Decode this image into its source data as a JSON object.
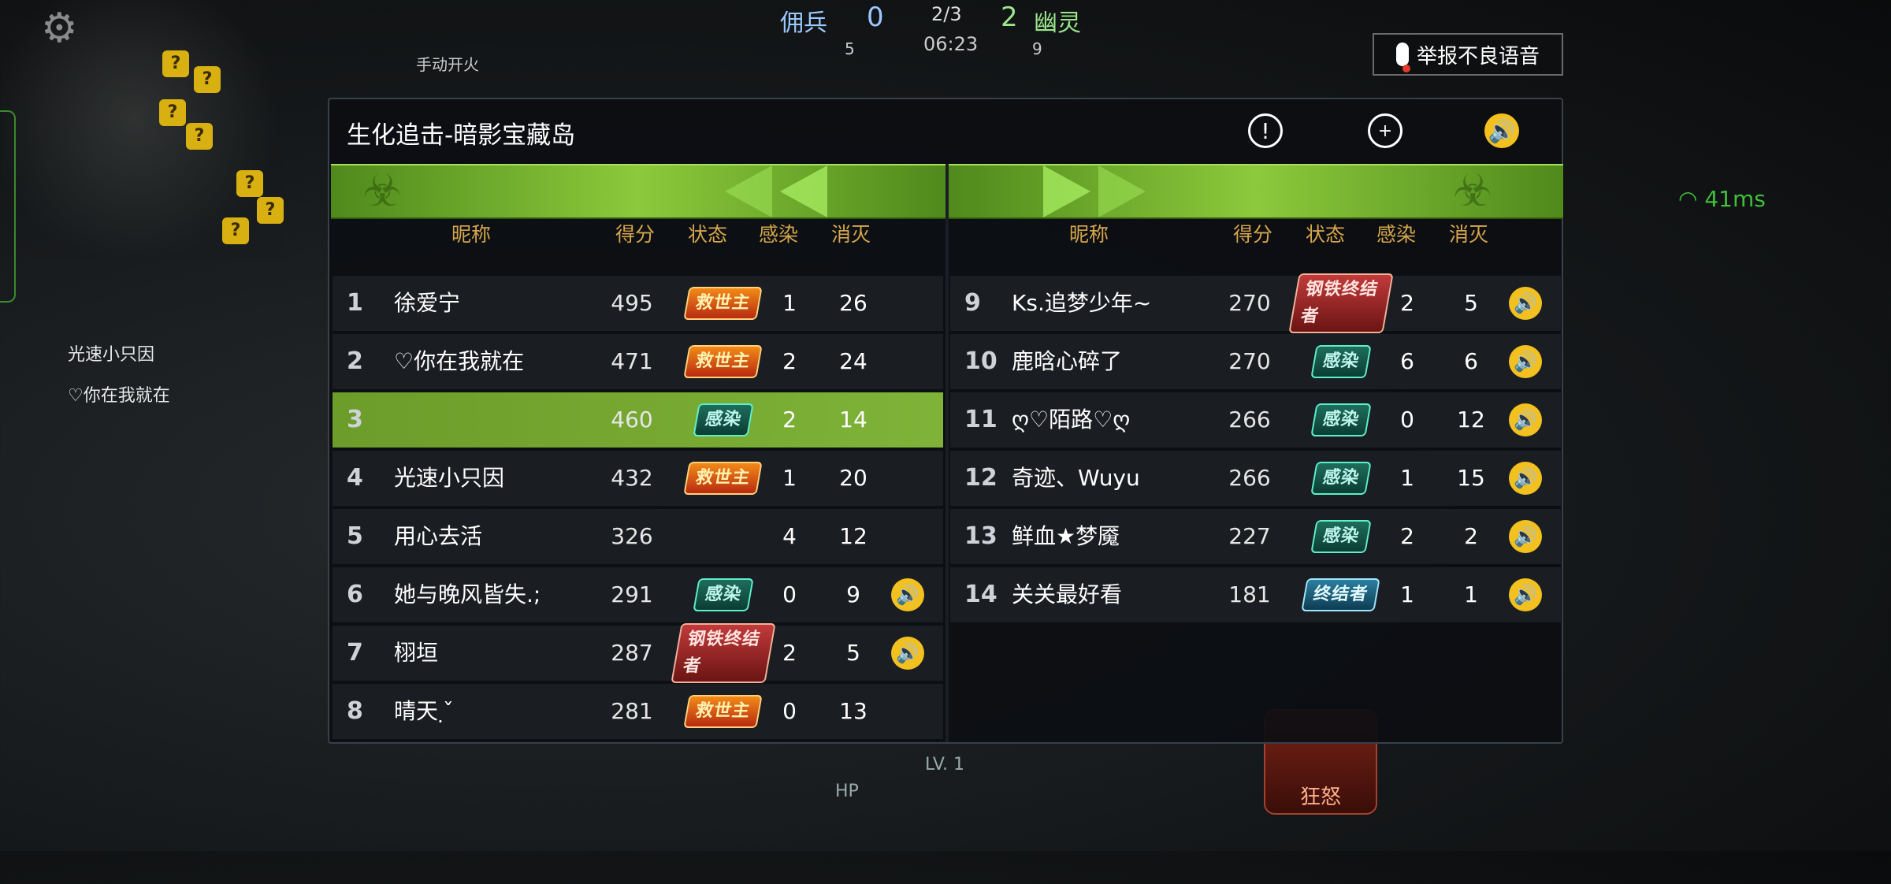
{
  "hud": {
    "left_team": "佣兵",
    "left_score": "0",
    "round": "2/3",
    "right_score": "2",
    "right_team": "幽灵",
    "left_count": "5",
    "timer": "06:23",
    "right_count": "9",
    "manual_fire": "手动开火",
    "ping": "41ms",
    "level": "LV. 1",
    "hp_label": "HP",
    "rage_label": "狂怒",
    "kill_feed": [
      "光速小只因",
      "♡你在我就在"
    ]
  },
  "report_button": {
    "label": "举报不良语音"
  },
  "scoreboard": {
    "title": "生化追击-暗影宝藏岛",
    "headers": {
      "name": "昵称",
      "score": "得分",
      "status": "状态",
      "infect": "感染",
      "kill": "消灭"
    },
    "left_rows": [
      {
        "rank": "1",
        "name": "徐爱宁",
        "score": "495",
        "status": "救世主",
        "status_type": "savior",
        "infect": "1",
        "kill": "26",
        "voice": false,
        "highlight": false
      },
      {
        "rank": "2",
        "name": "♡你在我就在",
        "score": "471",
        "status": "救世主",
        "status_type": "savior",
        "infect": "2",
        "kill": "24",
        "voice": false,
        "highlight": false
      },
      {
        "rank": "3",
        "name": "",
        "score": "460",
        "status": "感染",
        "status_type": "infected",
        "infect": "2",
        "kill": "14",
        "voice": false,
        "highlight": true
      },
      {
        "rank": "4",
        "name": "光速小只因",
        "score": "432",
        "status": "救世主",
        "status_type": "savior",
        "infect": "1",
        "kill": "20",
        "voice": false,
        "highlight": false
      },
      {
        "rank": "5",
        "name": "用心去活",
        "score": "326",
        "status": "",
        "status_type": "none",
        "infect": "4",
        "kill": "12",
        "voice": false,
        "highlight": false
      },
      {
        "rank": "6",
        "name": "她与晚风皆失.;",
        "score": "291",
        "status": "感染",
        "status_type": "infected",
        "infect": "0",
        "kill": "9",
        "voice": true,
        "highlight": false
      },
      {
        "rank": "7",
        "name": "栩垣",
        "score": "287",
        "status": "钢铁终结者",
        "status_type": "terminator",
        "infect": "2",
        "kill": "5",
        "voice": true,
        "highlight": false
      },
      {
        "rank": "8",
        "name": "晴天຺ˇ",
        "score": "281",
        "status": "救世主",
        "status_type": "savior",
        "infect": "0",
        "kill": "13",
        "voice": false,
        "highlight": false
      }
    ],
    "right_rows": [
      {
        "rank": "9",
        "name": "Ks.追梦少年~",
        "score": "270",
        "status": "钢铁终结者",
        "status_type": "terminator",
        "infect": "2",
        "kill": "5",
        "voice": true,
        "highlight": false
      },
      {
        "rank": "10",
        "name": "鹿晗心碎了",
        "score": "270",
        "status": "感染",
        "status_type": "infected",
        "infect": "6",
        "kill": "6",
        "voice": true,
        "highlight": false
      },
      {
        "rank": "11",
        "name": "ღ♡陌路♡ღ",
        "score": "266",
        "status": "感染",
        "status_type": "infected",
        "infect": "0",
        "kill": "12",
        "voice": true,
        "highlight": false
      },
      {
        "rank": "12",
        "name": "奇迹、Wuyu",
        "score": "266",
        "status": "感染",
        "status_type": "infected",
        "infect": "1",
        "kill": "15",
        "voice": true,
        "highlight": false
      },
      {
        "rank": "13",
        "name": "鲜血★梦魇",
        "score": "227",
        "status": "感染",
        "status_type": "infected",
        "infect": "2",
        "kill": "2",
        "voice": true,
        "highlight": false
      },
      {
        "rank": "14",
        "name": "关关最好看",
        "score": "181",
        "status": "终结者",
        "status_type": "ultimate",
        "infect": "1",
        "kill": "1",
        "voice": true,
        "highlight": false
      }
    ]
  }
}
